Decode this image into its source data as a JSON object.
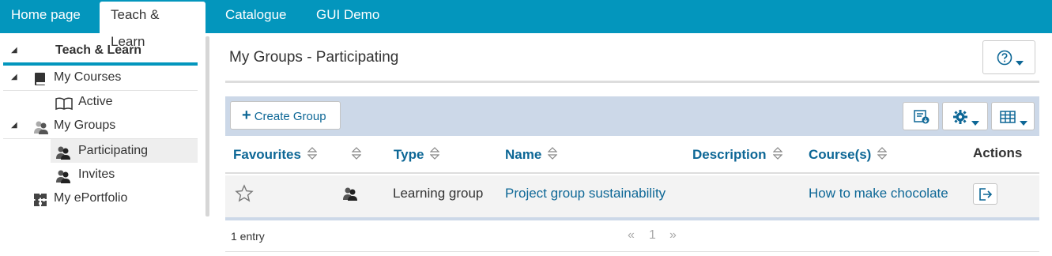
{
  "topnav": {
    "tabs": [
      {
        "label": "Home page"
      },
      {
        "label": "Teach & Learn"
      },
      {
        "label": "Catalogue"
      },
      {
        "label": "GUI Demo"
      }
    ]
  },
  "sidebar": {
    "title": "Teach & Learn",
    "items": [
      {
        "label": "My Courses",
        "icon": "book-icon"
      },
      {
        "label": "Active",
        "icon": "open-book-icon"
      },
      {
        "label": "My Groups",
        "icon": "group-icon"
      },
      {
        "label": "Participating",
        "icon": "group-icon"
      },
      {
        "label": "Invites",
        "icon": "group-icon"
      },
      {
        "label": "My ePortfolio",
        "icon": "puzzle-icon"
      }
    ]
  },
  "main": {
    "title": "My Groups - Participating",
    "help_icon": "question-circle-icon",
    "toolbar": {
      "create_label": "Create Group",
      "create_prefix": "+"
    },
    "table": {
      "columns": [
        {
          "label": "Favourites"
        },
        {
          "label": ""
        },
        {
          "label": "Type"
        },
        {
          "label": "Name"
        },
        {
          "label": "Description"
        },
        {
          "label": "Course(s)"
        },
        {
          "label": "Actions"
        }
      ],
      "rows": [
        {
          "type": "Learning group",
          "name": "Project group sustainability",
          "description": "",
          "courses": "How to make chocolate"
        }
      ]
    },
    "footer": {
      "entries": "1 entry",
      "prev": "«",
      "page": "1",
      "next": "»"
    }
  },
  "colors": {
    "topnav": "#0396bd",
    "link": "#0d6796",
    "toolbar": "#ccd8e8"
  }
}
